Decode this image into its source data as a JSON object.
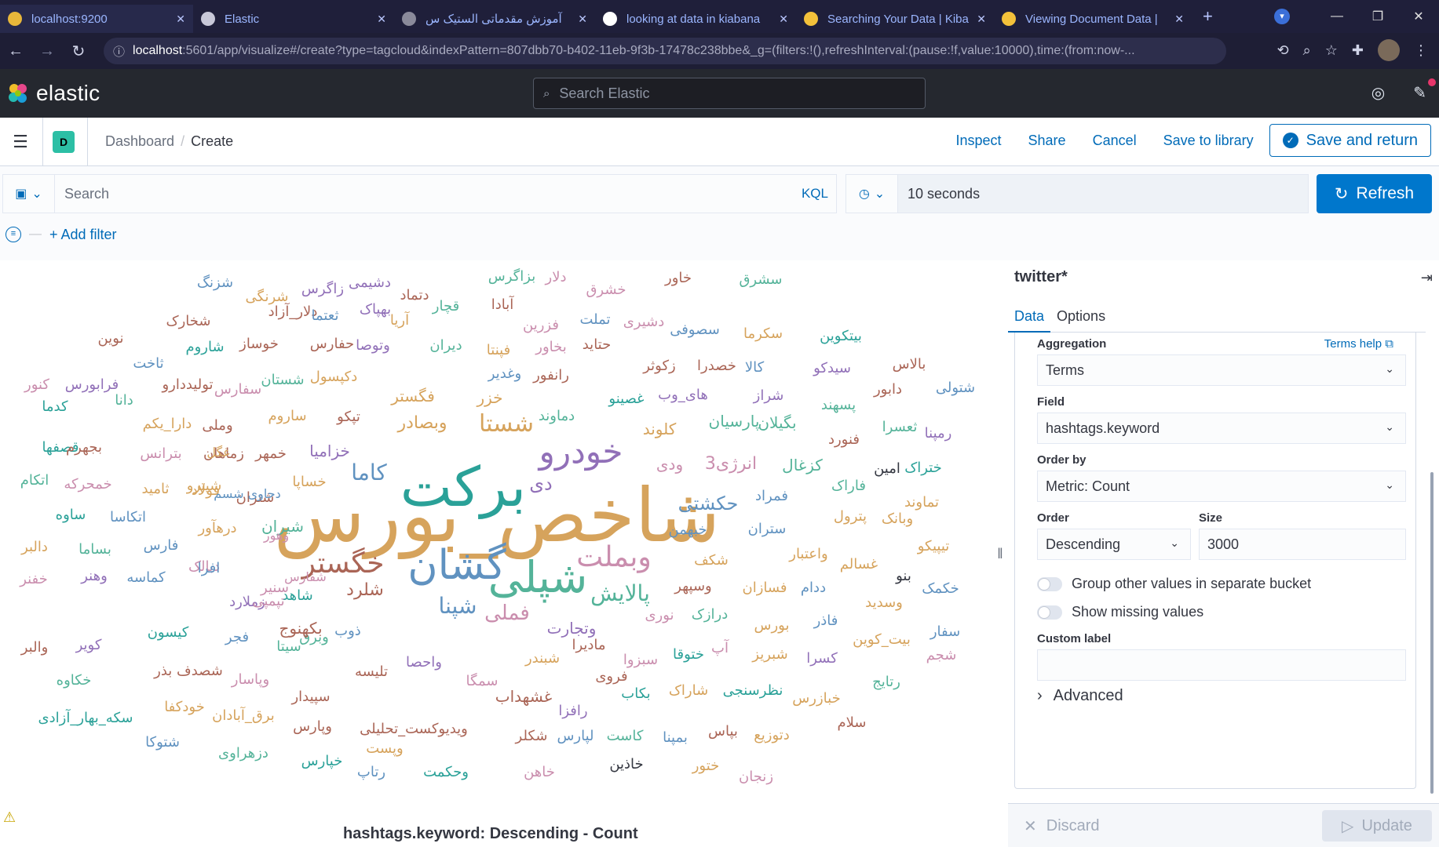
{
  "browser": {
    "tabs": [
      {
        "title": "localhost:9200",
        "icon_color": "#e8b73a"
      },
      {
        "title": "Elastic",
        "icon_color": "#c8c8d8"
      },
      {
        "title": "آموزش مقدماتی الستیک س",
        "icon_color": "#8a8a9a"
      },
      {
        "title": "looking at data in kiabana",
        "icon_color": "#ffffff"
      },
      {
        "title": "Searching Your Data | Kiba",
        "icon_color": "#f3c13a"
      },
      {
        "title": "Viewing Document Data |",
        "icon_color": "#f3c13a"
      }
    ],
    "url_host": "localhost",
    "url_rest": ":5601/app/visualize#/create?type=tagcloud&indexPattern=807dbb70-b402-11eb-9f3b-17478c238bbe&_g=(filters:!(),refreshInterval:(pause:!f,value:10000),time:(from:now-..."
  },
  "header": {
    "logo_text": "elastic",
    "search_placeholder": "Search Elastic"
  },
  "breadcrumbs": {
    "space_initial": "D",
    "items": [
      "Dashboard",
      "Create"
    ]
  },
  "top_actions": {
    "inspect": "Inspect",
    "share": "Share",
    "cancel": "Cancel",
    "save_to_library": "Save to library",
    "save_and_return": "Save and return"
  },
  "query": {
    "placeholder": "Search",
    "language": "KQL",
    "refresh_interval": "10 seconds",
    "refresh_label": "Refresh",
    "add_filter": "+ Add filter"
  },
  "cloud": {
    "caption": "hashtags.keyword: Descending - Count",
    "words": [
      {
        "t": "شاخص_بورس",
        "c": "#d6a35c"
      },
      {
        "t": "برکت",
        "c": "#2aa198"
      },
      {
        "t": "شپلی",
        "c": "#54b399"
      },
      {
        "t": "گشان",
        "c": "#6092c0"
      },
      {
        "t": "خودرو",
        "c": "#9170b8"
      },
      {
        "t": "وبملت",
        "c": "#ca8eae"
      },
      {
        "t": "خگستر",
        "c": "#aa6556"
      },
      {
        "t": "شستا",
        "c": "#d6a35c"
      },
      {
        "t": "کاما",
        "c": "#6092c0"
      },
      {
        "t": "پالایش",
        "c": "#54b399"
      },
      {
        "t": "شپنا",
        "c": "#6092c0"
      },
      {
        "t": "فملی",
        "c": "#ca8eae"
      },
      {
        "t": "حکشتی",
        "c": "#6092c0"
      },
      {
        "t": "شلرد",
        "c": "#aa6556"
      },
      {
        "t": "خزامیا",
        "c": "#9170b8"
      },
      {
        "t": "انرژی3",
        "c": "#ca8eae"
      },
      {
        "t": "کزغال",
        "c": "#54b399"
      },
      {
        "t": "دی",
        "c": "#9170b8"
      },
      {
        "t": "ودی",
        "c": "#ca8eae"
      },
      {
        "t": "کلوند",
        "c": "#d6a35c"
      },
      {
        "t": "پارسیان",
        "c": "#54b399"
      },
      {
        "t": "بگیلان",
        "c": "#54b399"
      },
      {
        "t": "فمراد",
        "c": "#6092c0"
      },
      {
        "t": "ستران",
        "c": "#6092c0"
      },
      {
        "t": "خبهمن",
        "c": "#6092c0"
      },
      {
        "t": "شتران",
        "c": "#aa6556"
      },
      {
        "t": "خساپا",
        "c": "#d6a35c"
      },
      {
        "t": "شیران",
        "c": "#54b399"
      },
      {
        "t": "درهآور",
        "c": "#d6a35c"
      },
      {
        "t": "شپترو",
        "c": "#d6a35c"
      },
      {
        "t": "وبصادر",
        "c": "#d6a35c"
      },
      {
        "t": "فگستر",
        "c": "#d6a35c"
      },
      {
        "t": "دماوند",
        "c": "#54b399"
      },
      {
        "t": "خزر",
        "c": "#d6a35c"
      },
      {
        "t": "غصینو",
        "c": "#2aa198"
      },
      {
        "t": "های_وب",
        "c": "#9170b8"
      },
      {
        "t": "شراز",
        "c": "#9170b8"
      },
      {
        "t": "پسهند",
        "c": "#54b399"
      },
      {
        "t": "دابور",
        "c": "#aa6556"
      },
      {
        "t": "شتولی",
        "c": "#6092c0"
      },
      {
        "t": "ثعسرا",
        "c": "#54b399"
      },
      {
        "t": "رمپنا",
        "c": "#9170b8"
      },
      {
        "t": "فنورد",
        "c": "#aa6556"
      },
      {
        "t": "امین",
        "c": "#343741"
      },
      {
        "t": "ختراک",
        "c": "#2aa198"
      },
      {
        "t": "فاراک",
        "c": "#54b399"
      },
      {
        "t": "تماوند",
        "c": "#d6a35c"
      },
      {
        "t": "پترول",
        "c": "#d6a35c"
      },
      {
        "t": "وبانک",
        "c": "#d6a35c"
      },
      {
        "t": "تیپیکو",
        "c": "#d6a35c"
      },
      {
        "t": "واعتبار",
        "c": "#d6a35c"
      },
      {
        "t": "شکف",
        "c": "#d6a35c"
      },
      {
        "t": "غسالم",
        "c": "#d6a35c"
      },
      {
        "t": "بنو",
        "c": "#343741"
      },
      {
        "t": "خکمک",
        "c": "#6092c0"
      },
      {
        "t": "وسپهر",
        "c": "#aa6556"
      },
      {
        "t": "فسازان",
        "c": "#d6a35c"
      },
      {
        "t": "ددام",
        "c": "#6092c0"
      },
      {
        "t": "وسدید",
        "c": "#d6a35c"
      },
      {
        "t": "نوری",
        "c": "#ca8eae"
      },
      {
        "t": "درازک",
        "c": "#54b399"
      },
      {
        "t": "بورس",
        "c": "#d6a35c"
      },
      {
        "t": "فاذر",
        "c": "#6092c0"
      },
      {
        "t": "بیت_کوین",
        "c": "#d6a35c"
      },
      {
        "t": "سفار",
        "c": "#6092c0"
      },
      {
        "t": "آپ",
        "c": "#ca8eae"
      },
      {
        "t": "ختوقا",
        "c": "#2aa198"
      },
      {
        "t": "شبریز",
        "c": "#d6a35c"
      },
      {
        "t": "کسرا",
        "c": "#9170b8"
      },
      {
        "t": "شجم",
        "c": "#ca8eae"
      },
      {
        "t": "رتایج",
        "c": "#54b399"
      },
      {
        "t": "وتجارت",
        "c": "#9170b8"
      },
      {
        "t": "شبندر",
        "c": "#d6a35c"
      },
      {
        "t": "سبزوا",
        "c": "#ca8eae"
      },
      {
        "t": "فروی",
        "c": "#aa6556"
      },
      {
        "t": "ماديرا",
        "c": "#aa6556"
      },
      {
        "t": "واحصا",
        "c": "#9170b8"
      },
      {
        "t": "تلیسه",
        "c": "#aa6556"
      },
      {
        "t": "سمگا",
        "c": "#ca8eae"
      },
      {
        "t": "وبرق",
        "c": "#54b399"
      },
      {
        "t": "ذوب",
        "c": "#6092c0"
      },
      {
        "t": "بکهنوج",
        "c": "#aa6556"
      },
      {
        "t": "نظرسنجی",
        "c": "#2aa198"
      },
      {
        "t": "شاراک",
        "c": "#d6a35c"
      },
      {
        "t": "بکاب",
        "c": "#2aa198"
      },
      {
        "t": "غشهداب",
        "c": "#aa6556"
      },
      {
        "t": "خبازرس",
        "c": "#d6a35c"
      },
      {
        "t": "سلام",
        "c": "#aa6556"
      },
      {
        "t": "دتوزیع",
        "c": "#d6a35c"
      },
      {
        "t": "بپاس",
        "c": "#aa6556"
      },
      {
        "t": "بمپنا",
        "c": "#6092c0"
      },
      {
        "t": "کاست",
        "c": "#54b399"
      },
      {
        "t": "لپارس",
        "c": "#6092c0"
      },
      {
        "t": "شکلر",
        "c": "#aa6556"
      },
      {
        "t": "رافزا",
        "c": "#9170b8"
      },
      {
        "t": "ویدیوکست_تحلیلی",
        "c": "#aa6556"
      },
      {
        "t": "سپیدار",
        "c": "#aa6556"
      },
      {
        "t": "وپارس",
        "c": "#aa6556"
      },
      {
        "t": "برق_آبادان",
        "c": "#d6a35c"
      },
      {
        "t": "خودکفا",
        "c": "#d6a35c"
      },
      {
        "t": "سکه_بهار_آزادی",
        "c": "#2aa198"
      },
      {
        "t": "شتوکا",
        "c": "#6092c0"
      },
      {
        "t": "دزهراوی",
        "c": "#54b399"
      },
      {
        "t": "خپارس",
        "c": "#2aa198"
      },
      {
        "t": "رتاپ",
        "c": "#6092c0"
      },
      {
        "t": "وپست",
        "c": "#d6a35c"
      },
      {
        "t": "وحکمت",
        "c": "#2aa198"
      },
      {
        "t": "خاهن",
        "c": "#ca8eae"
      },
      {
        "t": "خاذین",
        "c": "#343741"
      },
      {
        "t": "ختور",
        "c": "#d6a35c"
      },
      {
        "t": "زنجان",
        "c": "#ca8eae"
      },
      {
        "t": "شزنگ",
        "c": "#6092c0"
      },
      {
        "t": "شرنگی",
        "c": "#d6a35c"
      },
      {
        "t": "زاگرس",
        "c": "#9170b8"
      },
      {
        "t": "دشیمی",
        "c": "#9170b8"
      },
      {
        "t": "دتماد",
        "c": "#aa6556"
      },
      {
        "t": "بزاگرس",
        "c": "#54b399"
      },
      {
        "t": "دلار",
        "c": "#ca8eae"
      },
      {
        "t": "خشرق",
        "c": "#ca8eae"
      },
      {
        "t": "خاور",
        "c": "#aa6556"
      },
      {
        "t": "سشرق",
        "c": "#54b399"
      },
      {
        "t": "شخارک",
        "c": "#aa6556"
      },
      {
        "t": "دلار_آزاد",
        "c": "#aa6556"
      },
      {
        "t": "ثعتما",
        "c": "#6092c0"
      },
      {
        "t": "بهپاک",
        "c": "#9170b8"
      },
      {
        "t": "آریا",
        "c": "#d6a35c"
      },
      {
        "t": "قچار",
        "c": "#54b399"
      },
      {
        "t": "آبادا",
        "c": "#aa6556"
      },
      {
        "t": "فزرین",
        "c": "#ca8eae"
      },
      {
        "t": "تملت",
        "c": "#6092c0"
      },
      {
        "t": "دشیری",
        "c": "#ca8eae"
      },
      {
        "t": "سصوفی",
        "c": "#6092c0"
      },
      {
        "t": "سکرما",
        "c": "#d6a35c"
      },
      {
        "t": "بیتکوین",
        "c": "#2aa198"
      },
      {
        "t": "نوین",
        "c": "#aa6556"
      },
      {
        "t": "شاروم",
        "c": "#2aa198"
      },
      {
        "t": "خوساز",
        "c": "#aa6556"
      },
      {
        "t": "حفارس",
        "c": "#aa6556"
      },
      {
        "t": "وتوصا",
        "c": "#9170b8"
      },
      {
        "t": "دیران",
        "c": "#54b399"
      },
      {
        "t": "فپنتا",
        "c": "#d6a35c"
      },
      {
        "t": "بخاور",
        "c": "#ca8eae"
      },
      {
        "t": "حتاید",
        "c": "#aa6556"
      },
      {
        "t": "زکوثر",
        "c": "#aa6556"
      },
      {
        "t": "خصدرا",
        "c": "#aa6556"
      },
      {
        "t": "کالا",
        "c": "#6092c0"
      },
      {
        "t": "سیدکو",
        "c": "#9170b8"
      },
      {
        "t": "بالاس",
        "c": "#aa6556"
      },
      {
        "t": "ثاخت",
        "c": "#6092c0"
      },
      {
        "t": "کنور",
        "c": "#ca8eae"
      },
      {
        "t": "فرابورس",
        "c": "#9170b8"
      },
      {
        "t": "تولیددارو",
        "c": "#aa6556"
      },
      {
        "t": "سفارس",
        "c": "#ca8eae"
      },
      {
        "t": "شستان",
        "c": "#54b399"
      },
      {
        "t": "دکپسول",
        "c": "#d6a35c"
      },
      {
        "t": "وغدیر",
        "c": "#6092c0"
      },
      {
        "t": "رانفور",
        "c": "#aa6556"
      },
      {
        "t": "کدما",
        "c": "#2aa198"
      },
      {
        "t": "دانا",
        "c": "#54b399"
      },
      {
        "t": "دارا_یکم",
        "c": "#d6a35c"
      },
      {
        "t": "وملی",
        "c": "#aa6556"
      },
      {
        "t": "ساروم",
        "c": "#d6a35c"
      },
      {
        "t": "تپکو",
        "c": "#aa6556"
      },
      {
        "t": "قصفها",
        "c": "#2aa198"
      },
      {
        "t": "بجهرم",
        "c": "#aa6556"
      },
      {
        "t": "بترانس",
        "c": "#ca8eae"
      },
      {
        "t": "زماهان",
        "c": "#aa6556"
      },
      {
        "t": "خمهر",
        "c": "#aa6556"
      },
      {
        "t": "اتکام",
        "c": "#54b399"
      },
      {
        "t": "خمحرکه",
        "c": "#ca8eae"
      },
      {
        "t": "ثامید",
        "c": "#d6a35c"
      },
      {
        "t": "فولاد",
        "c": "#d6a35c"
      },
      {
        "t": "ساوه",
        "c": "#2aa198"
      },
      {
        "t": "اتکاسا",
        "c": "#6092c0"
      },
      {
        "t": "دالبر",
        "c": "#d6a35c"
      },
      {
        "t": "بساما",
        "c": "#54b399"
      },
      {
        "t": "فارس",
        "c": "#6092c0"
      },
      {
        "t": "خفنر",
        "c": "#ca8eae"
      },
      {
        "t": "وهنر",
        "c": "#9170b8"
      },
      {
        "t": "کماسه",
        "c": "#6092c0"
      },
      {
        "t": "دبالک",
        "c": "#ca8eae"
      },
      {
        "t": "افرا",
        "c": "#6092c0"
      },
      {
        "t": "سنیر",
        "c": "#ca8eae"
      },
      {
        "t": "زملارد",
        "c": "#9170b8"
      },
      {
        "t": "شاهد",
        "c": "#2aa198"
      },
      {
        "t": "تپمپی",
        "c": "#ca8eae"
      },
      {
        "t": "والبر",
        "c": "#aa6556"
      },
      {
        "t": "کویر",
        "c": "#9170b8"
      },
      {
        "t": "کیسون",
        "c": "#2aa198"
      },
      {
        "t": "فجر",
        "c": "#6092c0"
      },
      {
        "t": "سیتا",
        "c": "#54b399"
      },
      {
        "t": "خکاوه",
        "c": "#54b399"
      },
      {
        "t": "شصدف بذر",
        "c": "#aa6556"
      },
      {
        "t": "وپاسار",
        "c": "#ca8eae"
      },
      {
        "t": "غگل",
        "c": "#d6a35c"
      },
      {
        "t": "دحاوی شسم",
        "c": "#6092c0"
      },
      {
        "t": "وهور",
        "c": "#ca8eae"
      },
      {
        "t": "شفارس",
        "c": "#ca8eae"
      }
    ]
  },
  "sidebar": {
    "title": "twitter*",
    "tabs": [
      "Data",
      "Options"
    ],
    "aggregation_label": "Aggregation",
    "terms_help": "Terms help",
    "aggregation_value": "Terms",
    "field_label": "Field",
    "field_value": "hashtags.keyword",
    "order_by_label": "Order by",
    "order_by_value": "Metric: Count",
    "order_label": "Order",
    "order_value": "Descending",
    "size_label": "Size",
    "size_value": "3000",
    "group_other": "Group other values in separate bucket",
    "show_missing": "Show missing values",
    "custom_label": "Custom label",
    "custom_value": "",
    "advanced": "Advanced",
    "discard": "Discard",
    "update": "Update"
  }
}
